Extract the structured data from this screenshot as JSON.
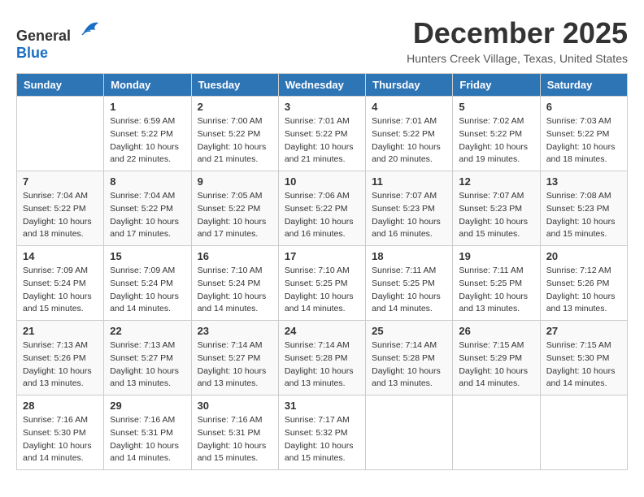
{
  "header": {
    "logo_general": "General",
    "logo_blue": "Blue",
    "month_title": "December 2025",
    "location": "Hunters Creek Village, Texas, United States"
  },
  "weekdays": [
    "Sunday",
    "Monday",
    "Tuesday",
    "Wednesday",
    "Thursday",
    "Friday",
    "Saturday"
  ],
  "weeks": [
    [
      {
        "day": "",
        "info": ""
      },
      {
        "day": "1",
        "info": "Sunrise: 6:59 AM\nSunset: 5:22 PM\nDaylight: 10 hours\nand 22 minutes."
      },
      {
        "day": "2",
        "info": "Sunrise: 7:00 AM\nSunset: 5:22 PM\nDaylight: 10 hours\nand 21 minutes."
      },
      {
        "day": "3",
        "info": "Sunrise: 7:01 AM\nSunset: 5:22 PM\nDaylight: 10 hours\nand 21 minutes."
      },
      {
        "day": "4",
        "info": "Sunrise: 7:01 AM\nSunset: 5:22 PM\nDaylight: 10 hours\nand 20 minutes."
      },
      {
        "day": "5",
        "info": "Sunrise: 7:02 AM\nSunset: 5:22 PM\nDaylight: 10 hours\nand 19 minutes."
      },
      {
        "day": "6",
        "info": "Sunrise: 7:03 AM\nSunset: 5:22 PM\nDaylight: 10 hours\nand 18 minutes."
      }
    ],
    [
      {
        "day": "7",
        "info": "Sunrise: 7:04 AM\nSunset: 5:22 PM\nDaylight: 10 hours\nand 18 minutes."
      },
      {
        "day": "8",
        "info": "Sunrise: 7:04 AM\nSunset: 5:22 PM\nDaylight: 10 hours\nand 17 minutes."
      },
      {
        "day": "9",
        "info": "Sunrise: 7:05 AM\nSunset: 5:22 PM\nDaylight: 10 hours\nand 17 minutes."
      },
      {
        "day": "10",
        "info": "Sunrise: 7:06 AM\nSunset: 5:22 PM\nDaylight: 10 hours\nand 16 minutes."
      },
      {
        "day": "11",
        "info": "Sunrise: 7:07 AM\nSunset: 5:23 PM\nDaylight: 10 hours\nand 16 minutes."
      },
      {
        "day": "12",
        "info": "Sunrise: 7:07 AM\nSunset: 5:23 PM\nDaylight: 10 hours\nand 15 minutes."
      },
      {
        "day": "13",
        "info": "Sunrise: 7:08 AM\nSunset: 5:23 PM\nDaylight: 10 hours\nand 15 minutes."
      }
    ],
    [
      {
        "day": "14",
        "info": "Sunrise: 7:09 AM\nSunset: 5:24 PM\nDaylight: 10 hours\nand 15 minutes."
      },
      {
        "day": "15",
        "info": "Sunrise: 7:09 AM\nSunset: 5:24 PM\nDaylight: 10 hours\nand 14 minutes."
      },
      {
        "day": "16",
        "info": "Sunrise: 7:10 AM\nSunset: 5:24 PM\nDaylight: 10 hours\nand 14 minutes."
      },
      {
        "day": "17",
        "info": "Sunrise: 7:10 AM\nSunset: 5:25 PM\nDaylight: 10 hours\nand 14 minutes."
      },
      {
        "day": "18",
        "info": "Sunrise: 7:11 AM\nSunset: 5:25 PM\nDaylight: 10 hours\nand 14 minutes."
      },
      {
        "day": "19",
        "info": "Sunrise: 7:11 AM\nSunset: 5:25 PM\nDaylight: 10 hours\nand 13 minutes."
      },
      {
        "day": "20",
        "info": "Sunrise: 7:12 AM\nSunset: 5:26 PM\nDaylight: 10 hours\nand 13 minutes."
      }
    ],
    [
      {
        "day": "21",
        "info": "Sunrise: 7:13 AM\nSunset: 5:26 PM\nDaylight: 10 hours\nand 13 minutes."
      },
      {
        "day": "22",
        "info": "Sunrise: 7:13 AM\nSunset: 5:27 PM\nDaylight: 10 hours\nand 13 minutes."
      },
      {
        "day": "23",
        "info": "Sunrise: 7:14 AM\nSunset: 5:27 PM\nDaylight: 10 hours\nand 13 minutes."
      },
      {
        "day": "24",
        "info": "Sunrise: 7:14 AM\nSunset: 5:28 PM\nDaylight: 10 hours\nand 13 minutes."
      },
      {
        "day": "25",
        "info": "Sunrise: 7:14 AM\nSunset: 5:28 PM\nDaylight: 10 hours\nand 13 minutes."
      },
      {
        "day": "26",
        "info": "Sunrise: 7:15 AM\nSunset: 5:29 PM\nDaylight: 10 hours\nand 14 minutes."
      },
      {
        "day": "27",
        "info": "Sunrise: 7:15 AM\nSunset: 5:30 PM\nDaylight: 10 hours\nand 14 minutes."
      }
    ],
    [
      {
        "day": "28",
        "info": "Sunrise: 7:16 AM\nSunset: 5:30 PM\nDaylight: 10 hours\nand 14 minutes."
      },
      {
        "day": "29",
        "info": "Sunrise: 7:16 AM\nSunset: 5:31 PM\nDaylight: 10 hours\nand 14 minutes."
      },
      {
        "day": "30",
        "info": "Sunrise: 7:16 AM\nSunset: 5:31 PM\nDaylight: 10 hours\nand 15 minutes."
      },
      {
        "day": "31",
        "info": "Sunrise: 7:17 AM\nSunset: 5:32 PM\nDaylight: 10 hours\nand 15 minutes."
      },
      {
        "day": "",
        "info": ""
      },
      {
        "day": "",
        "info": ""
      },
      {
        "day": "",
        "info": ""
      }
    ]
  ]
}
